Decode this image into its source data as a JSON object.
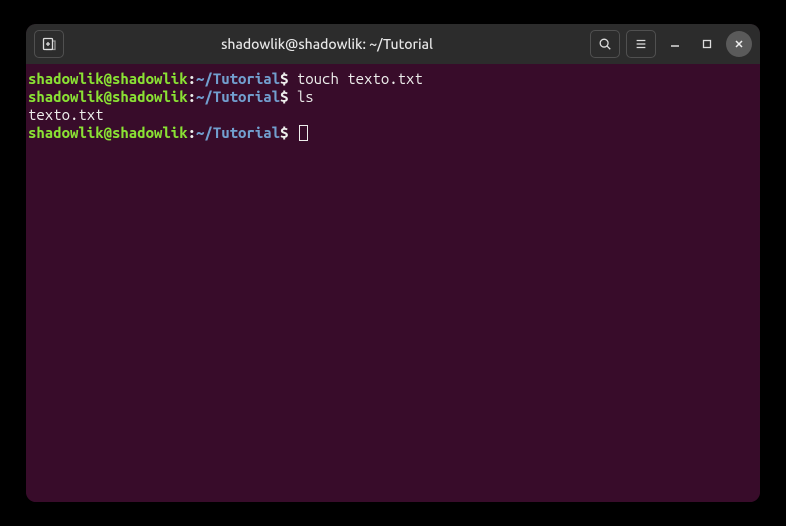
{
  "window": {
    "title": "shadowlik@shadowlik: ~/Tutorial"
  },
  "terminal": {
    "lines": [
      {
        "user_host": "shadowlik@shadowlik",
        "colon": ":",
        "path": "~/Tutorial",
        "dollar": "$",
        "command": " touch texto.txt"
      },
      {
        "user_host": "shadowlik@shadowlik",
        "colon": ":",
        "path": "~/Tutorial",
        "dollar": "$",
        "command": " ls"
      },
      {
        "output": "texto.txt"
      },
      {
        "user_host": "shadowlik@shadowlik",
        "colon": ":",
        "path": "~/Tutorial",
        "dollar": "$",
        "command": " ",
        "cursor": true
      }
    ]
  }
}
